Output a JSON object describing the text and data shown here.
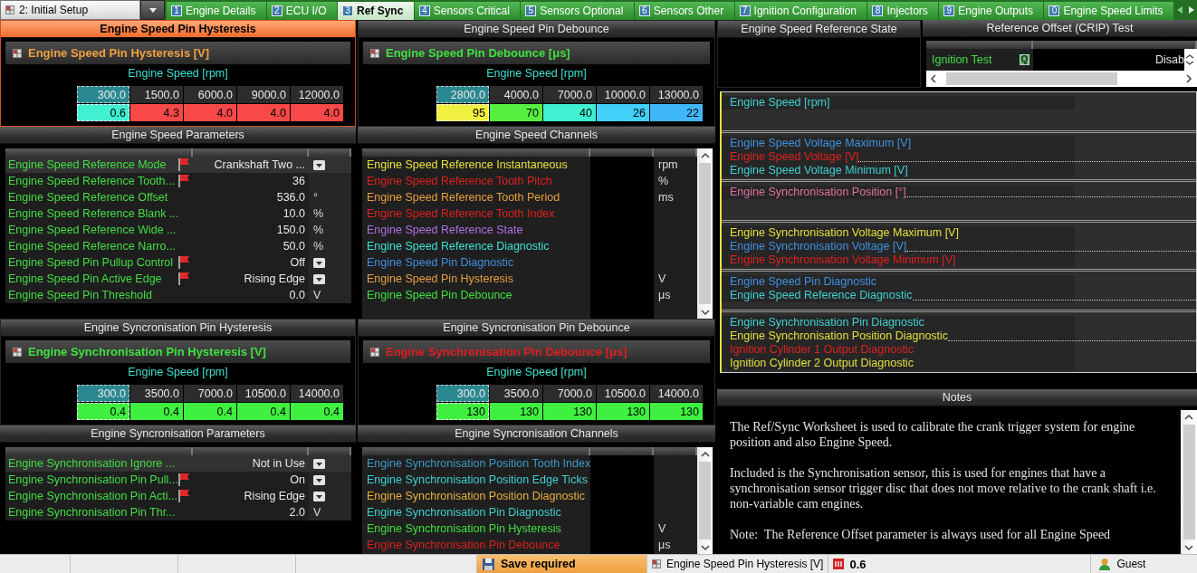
{
  "setup_selector": {
    "value": "2: Initial Setup"
  },
  "tabs": [
    {
      "key": "1",
      "label": "Engine Details",
      "selected": false
    },
    {
      "key": "2",
      "label": "ECU I/O",
      "selected": false
    },
    {
      "key": "3",
      "label": "Ref Sync",
      "selected": true
    },
    {
      "key": "4",
      "label": "Sensors Critical",
      "selected": false
    },
    {
      "key": "5",
      "label": "Sensors Optional",
      "selected": false
    },
    {
      "key": "6",
      "label": "Sensors Other",
      "selected": false
    },
    {
      "key": "7",
      "label": "Ignition Configuration",
      "selected": false
    },
    {
      "key": "8",
      "label": "Injectors",
      "selected": false
    },
    {
      "key": "9",
      "label": "Engine Outputs",
      "selected": false
    },
    {
      "key": "0",
      "label": "Engine Speed Limits",
      "selected": false
    }
  ],
  "panels": [
    {
      "kind": "map",
      "title": "Engine Speed Pin Hysteresis",
      "focused": true,
      "table_title": "Engine Speed Pin Hysteresis [V]",
      "color": "#f0a040",
      "axis_label": "Engine Speed [rpm]",
      "axis": [
        "300.0",
        "1500.0",
        "6000.0",
        "9000.0",
        "12000.0"
      ],
      "cells": [
        {
          "value": "0.6",
          "color": "#40f0d0",
          "selected": true
        },
        {
          "value": "4.3",
          "color": "#f84848",
          "selected": false
        },
        {
          "value": "4.0",
          "color": "#f84848",
          "selected": false
        },
        {
          "value": "4.0",
          "color": "#f84848",
          "selected": false
        },
        {
          "value": "4.0",
          "color": "#f84848",
          "selected": false
        }
      ]
    },
    {
      "kind": "map",
      "title": "Engine Speed Pin Debounce",
      "focused": false,
      "table_title": "Engine Speed Pin Debounce [μs]",
      "color": "#40e040",
      "axis_label": "Engine Speed [rpm]",
      "axis": [
        "2800.0",
        "4000.0",
        "7000.0",
        "10000.0",
        "13000.0"
      ],
      "cells": [
        {
          "value": "95",
          "color": "#f0f040",
          "selected": true
        },
        {
          "value": "70",
          "color": "#58f040",
          "selected": false
        },
        {
          "value": "40",
          "color": "#40f0d0",
          "selected": false
        },
        {
          "value": "26",
          "color": "#40d0f8",
          "selected": false
        },
        {
          "value": "22",
          "color": "#40b8f8",
          "selected": false
        }
      ]
    },
    {
      "kind": "params",
      "title": "Engine Speed Parameters",
      "rows": [
        {
          "name": "Engine Speed Reference Mode",
          "flag": true,
          "value": "Crankshaft Two ...",
          "kind": "dropdown",
          "selected": true
        },
        {
          "name": "Engine Speed Reference Tooth...",
          "flag": true,
          "value": "36",
          "kind": "number",
          "selected": false
        },
        {
          "name": "Engine Speed Reference Offset",
          "flag": false,
          "value": "536.0",
          "unit": "°",
          "kind": "number",
          "selected": false
        },
        {
          "name": "Engine Speed Reference Blank ...",
          "flag": false,
          "value": "10.0",
          "unit": "%",
          "kind": "number",
          "selected": false
        },
        {
          "name": "Engine Speed Reference Wide ...",
          "flag": false,
          "value": "150.0",
          "unit": "%",
          "kind": "number",
          "selected": false
        },
        {
          "name": "Engine Speed Reference Narro...",
          "flag": false,
          "value": "50.0",
          "unit": "%",
          "kind": "number",
          "selected": false
        },
        {
          "name": "Engine Speed Pin Pullup Control",
          "flag": true,
          "value": "Off",
          "kind": "dropdown",
          "selected": false
        },
        {
          "name": "Engine Speed Pin Active Edge",
          "flag": true,
          "value": "Rising Edge",
          "kind": "dropdown",
          "selected": false
        },
        {
          "name": "Engine Speed Pin Threshold",
          "flag": false,
          "value": "0.0",
          "unit": "V",
          "kind": "number",
          "selected": false
        }
      ]
    },
    {
      "kind": "channels",
      "title": "Engine Speed Channels",
      "rows": [
        {
          "name": "Engine Speed Reference Instantaneous",
          "unit": "rpm",
          "color": "#e8e040"
        },
        {
          "name": "Engine Speed Reference Tooth Pitch",
          "unit": "%",
          "color": "#e02020"
        },
        {
          "name": "Engine Speed Reference Tooth Period",
          "unit": "ms",
          "color": "#e8a040"
        },
        {
          "name": "Engine Speed Reference Tooth Index",
          "color": "#e02020"
        },
        {
          "name": "Engine Speed Reference State",
          "color": "#b070e0"
        },
        {
          "name": "Engine Speed Reference Diagnostic",
          "color": "#40e0d0"
        },
        {
          "name": "Engine Speed Pin Diagnostic",
          "color": "#4090e0"
        },
        {
          "name": "Engine Speed Pin Hysteresis",
          "unit": "V",
          "color": "#e8a040"
        },
        {
          "name": "Engine Speed Pin Debounce",
          "unit": "μs",
          "color": "#40e040"
        }
      ]
    },
    {
      "kind": "map",
      "title": "Engine Syncronisation Pin Hysteresis",
      "focused": false,
      "table_title": "Engine Synchronisation Pin Hysteresis [V]",
      "color": "#40e040",
      "axis_label": "Engine Speed [rpm]",
      "axis": [
        "300.0",
        "3500.0",
        "7000.0",
        "10500.0",
        "14000.0"
      ],
      "cells": [
        {
          "value": "0.4",
          "color": "#40f040",
          "selected": true
        },
        {
          "value": "0.4",
          "color": "#40f040",
          "selected": false
        },
        {
          "value": "0.4",
          "color": "#40f040",
          "selected": false
        },
        {
          "value": "0.4",
          "color": "#40f040",
          "selected": false
        },
        {
          "value": "0.4",
          "color": "#40f040",
          "selected": false
        }
      ]
    },
    {
      "kind": "map",
      "title": "Engine Syncronisation Pin Debounce",
      "focused": false,
      "table_title": "Engine Synchronisation Pin Debounce [μs]",
      "color": "#e02020",
      "axis_label": "Engine Speed [rpm]",
      "axis": [
        "300.0",
        "3500.0",
        "7000.0",
        "10500.0",
        "14000.0"
      ],
      "cells": [
        {
          "value": "130",
          "color": "#40f040",
          "selected": true
        },
        {
          "value": "130",
          "color": "#40f040",
          "selected": false
        },
        {
          "value": "130",
          "color": "#40f040",
          "selected": false
        },
        {
          "value": "130",
          "color": "#40f040",
          "selected": false
        },
        {
          "value": "130",
          "color": "#40f040",
          "selected": false
        }
      ]
    },
    {
      "kind": "params",
      "title": "Engine Syncronisation Parameters",
      "rows": [
        {
          "name": "Engine Synchronisation Ignore ...",
          "flag": false,
          "value": "Not in Use",
          "kind": "dropdown",
          "selected": true
        },
        {
          "name": "Engine Synchronisation Pin Pull...",
          "flag": true,
          "value": "On",
          "kind": "dropdown",
          "selected": false
        },
        {
          "name": "Engine Synchronisation Pin Acti...",
          "flag": true,
          "value": "Rising Edge",
          "kind": "dropdown",
          "selected": false
        },
        {
          "name": "Engine Synchronisation Pin Thr...",
          "flag": false,
          "value": "2.0",
          "unit": "V",
          "kind": "number",
          "selected": false
        }
      ]
    },
    {
      "kind": "channels",
      "title": "Engine Syncronisation Channels",
      "rows": [
        {
          "name": "Engine Synchronisation Position Tooth Index",
          "color": "#4098c8"
        },
        {
          "name": "Engine Synchronisation Position Edge Ticks",
          "color": "#40d0d0"
        },
        {
          "name": "Engine Synchronisation Position Diagnostic",
          "color": "#e8b040"
        },
        {
          "name": "Engine Synchronisation Pin Diagnostic",
          "color": "#40d0d0"
        },
        {
          "name": "Engine Synchronisation Pin Hysteresis",
          "unit": "V",
          "color": "#40e040"
        },
        {
          "name": "Engine Synchronisation Pin Debounce",
          "unit": "μs",
          "color": "#e02020"
        }
      ]
    }
  ],
  "ref_state": {
    "title": "Engine Speed Reference State"
  },
  "crip_test": {
    "title": "Reference Offset (CRIP) Test",
    "name": "Ignition Test",
    "badge": "Q",
    "value": "Disab"
  },
  "graph": {
    "groups": [
      {
        "channels": [
          {
            "name": "Engine Speed [rpm]",
            "color": "#40d0d0",
            "trace": false
          }
        ]
      },
      {
        "channels": [
          {
            "name": "Engine Speed Voltage Maximum [V]",
            "color": "#4090e0",
            "trace": false
          },
          {
            "name": "Engine Speed Voltage [V]",
            "color": "#e02020",
            "trace": true
          },
          {
            "name": "Engine Speed Voltage Minimum [V]",
            "color": "#40d0d0",
            "trace": false
          }
        ]
      },
      {
        "channels": [
          {
            "name": "Engine Synchronisation Position [°]",
            "color": "#e070a0",
            "trace": true
          }
        ]
      },
      {
        "channels": [
          {
            "name": "Engine Synchronisation Voltage Maximum [V]",
            "color": "#e0e040",
            "trace": false
          },
          {
            "name": "Engine Synchronisation Voltage [V]",
            "color": "#4090e0",
            "trace": true
          },
          {
            "name": "Engine Synchronisation Voltage Minimum [V]",
            "color": "#e02020",
            "trace": false
          }
        ]
      },
      {
        "channels": [
          {
            "name": "Engine Speed Pin Diagnostic",
            "color": "#4090e0",
            "trace": false
          },
          {
            "name": "Engine Speed Reference Diagnostic",
            "color": "#40d0d0",
            "trace": true
          }
        ]
      },
      {
        "channels": [
          {
            "name": "Engine Synchronisation Pin Diagnostic",
            "color": "#40d0d0",
            "trace": false
          },
          {
            "name": "Engine Synchronisation Position Diagnostic",
            "color": "#e0e040",
            "trace": true
          },
          {
            "name": "Ignition Cylinder 1 Output Diagnostic",
            "color": "#e02020",
            "trace": false
          },
          {
            "name": "Ignition Cylinder 2 Output Diagnostic",
            "color": "#e0e040",
            "trace": false
          }
        ]
      }
    ]
  },
  "notes": {
    "title": "Notes",
    "paragraphs": [
      "The Ref/Sync Worksheet is used to calibrate the crank trigger system for engine position and also Engine Speed.",
      "Included is the Synchronisation sensor, this is used for engines that have a synchronisation sensor trigger disc that does not move relative to the crank shaft i.e. non-variable cam engines.",
      "Note:  The Reference Offset parameter is always used for all Engine Speed"
    ]
  },
  "status_bar": {
    "save_state": "Save required",
    "context": "Engine Speed Pin Hysteresis [V]",
    "value": "0.6",
    "user": "Guest"
  }
}
